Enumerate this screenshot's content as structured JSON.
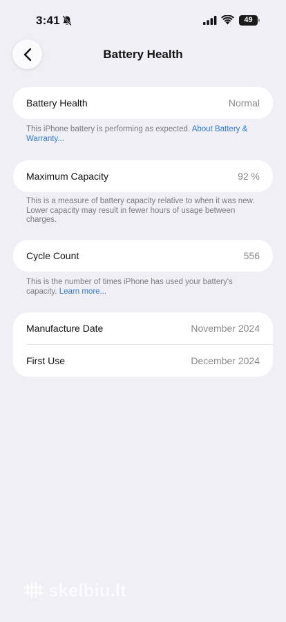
{
  "status_bar": {
    "time": "3:41",
    "battery_percent": "49",
    "icons": [
      "bell-slash-icon",
      "signal-icon",
      "wifi-icon",
      "battery-icon"
    ]
  },
  "header": {
    "title": "Battery Health",
    "back_icon": "chevron-left-icon"
  },
  "sections": {
    "battery_health": {
      "label": "Battery Health",
      "value": "Normal",
      "footnote_text": "This iPhone battery is performing as expected. ",
      "footnote_link": "About Battery & Warranty..."
    },
    "maximum_capacity": {
      "label": "Maximum Capacity",
      "value": "92 %",
      "footnote_text": "This is a measure of battery capacity relative to when it was new. Lower capacity may result in fewer hours of usage between charges."
    },
    "cycle_count": {
      "label": "Cycle Count",
      "value": "556",
      "footnote_text": "This is the number of times iPhone has used your battery's capacity. ",
      "footnote_link": "Learn more..."
    },
    "dates": {
      "manufacture_label": "Manufacture Date",
      "manufacture_value": "November 2024",
      "first_use_label": "First Use",
      "first_use_value": "December 2024"
    }
  },
  "watermark": {
    "text": "skelbiu.lt"
  },
  "colors": {
    "background": "#f0eff5",
    "link": "#2f7bdc",
    "secondary_text": "#8a8a8e"
  }
}
